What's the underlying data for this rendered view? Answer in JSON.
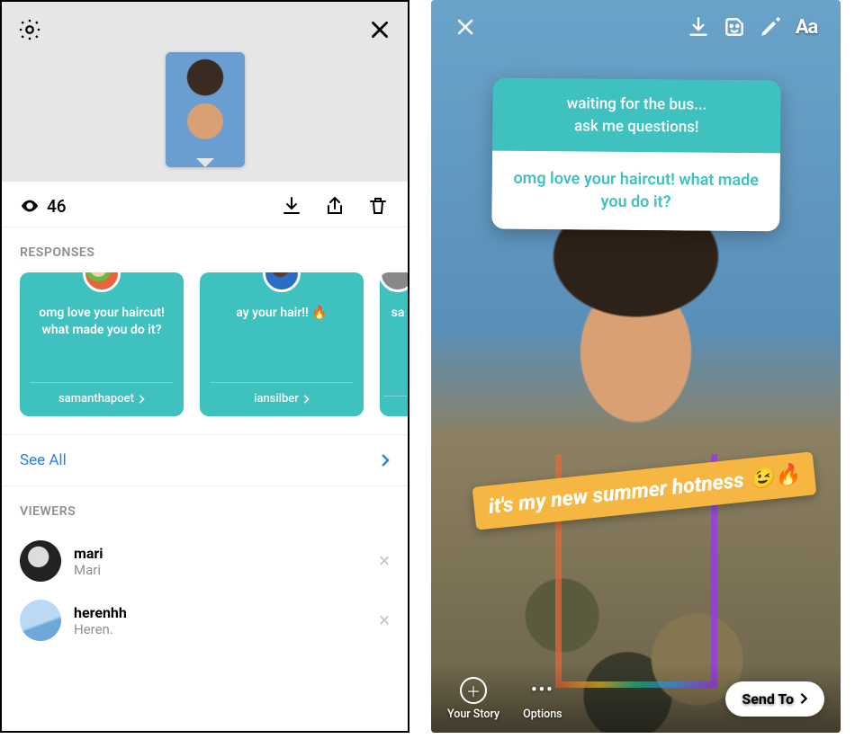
{
  "left": {
    "views_count": "46",
    "sections": {
      "responses_label": "RESPONSES",
      "viewers_label": "VIEWERS"
    },
    "responses": [
      {
        "text": "omg love your haircut! what made you do it?",
        "user": "samanthapoet"
      },
      {
        "text": "ay your hair!! 🔥",
        "user": "iansilber"
      },
      {
        "text": "sa",
        "user": ""
      }
    ],
    "see_all_label": "See All",
    "viewers": [
      {
        "username": "mari",
        "display": "Mari"
      },
      {
        "username": "herenhh",
        "display": "Heren."
      }
    ]
  },
  "right": {
    "question": {
      "prompt_line1": "waiting for the bus...",
      "prompt_line2": "ask me questions!",
      "answer": "omg love your haircut! what made you do it?"
    },
    "caption": "it's my new summer hotness 😉🔥",
    "tools_text_label": "Aa",
    "bottom": {
      "your_story": "Your Story",
      "options": "Options",
      "send_to": "Send To"
    }
  },
  "colors": {
    "teal": "#3fc1c0",
    "link_blue": "#2680eb",
    "muted": "#8e8e8e",
    "caption_bg": "#f5b642"
  }
}
